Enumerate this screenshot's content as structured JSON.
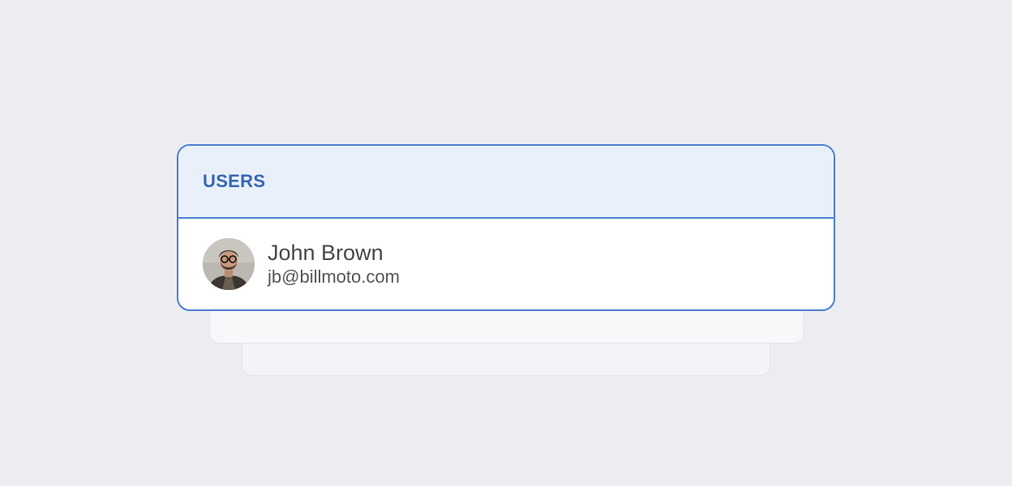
{
  "panel": {
    "title": "USERS"
  },
  "users": [
    {
      "name": "John Brown",
      "email": "jb@billmoto.com",
      "avatar_icon": "user-photo-avatar"
    }
  ],
  "colors": {
    "background": "#ecedf1",
    "accent": "#4a7fd1",
    "header_bg": "#eaf0fa",
    "title_text": "#3566b5"
  }
}
